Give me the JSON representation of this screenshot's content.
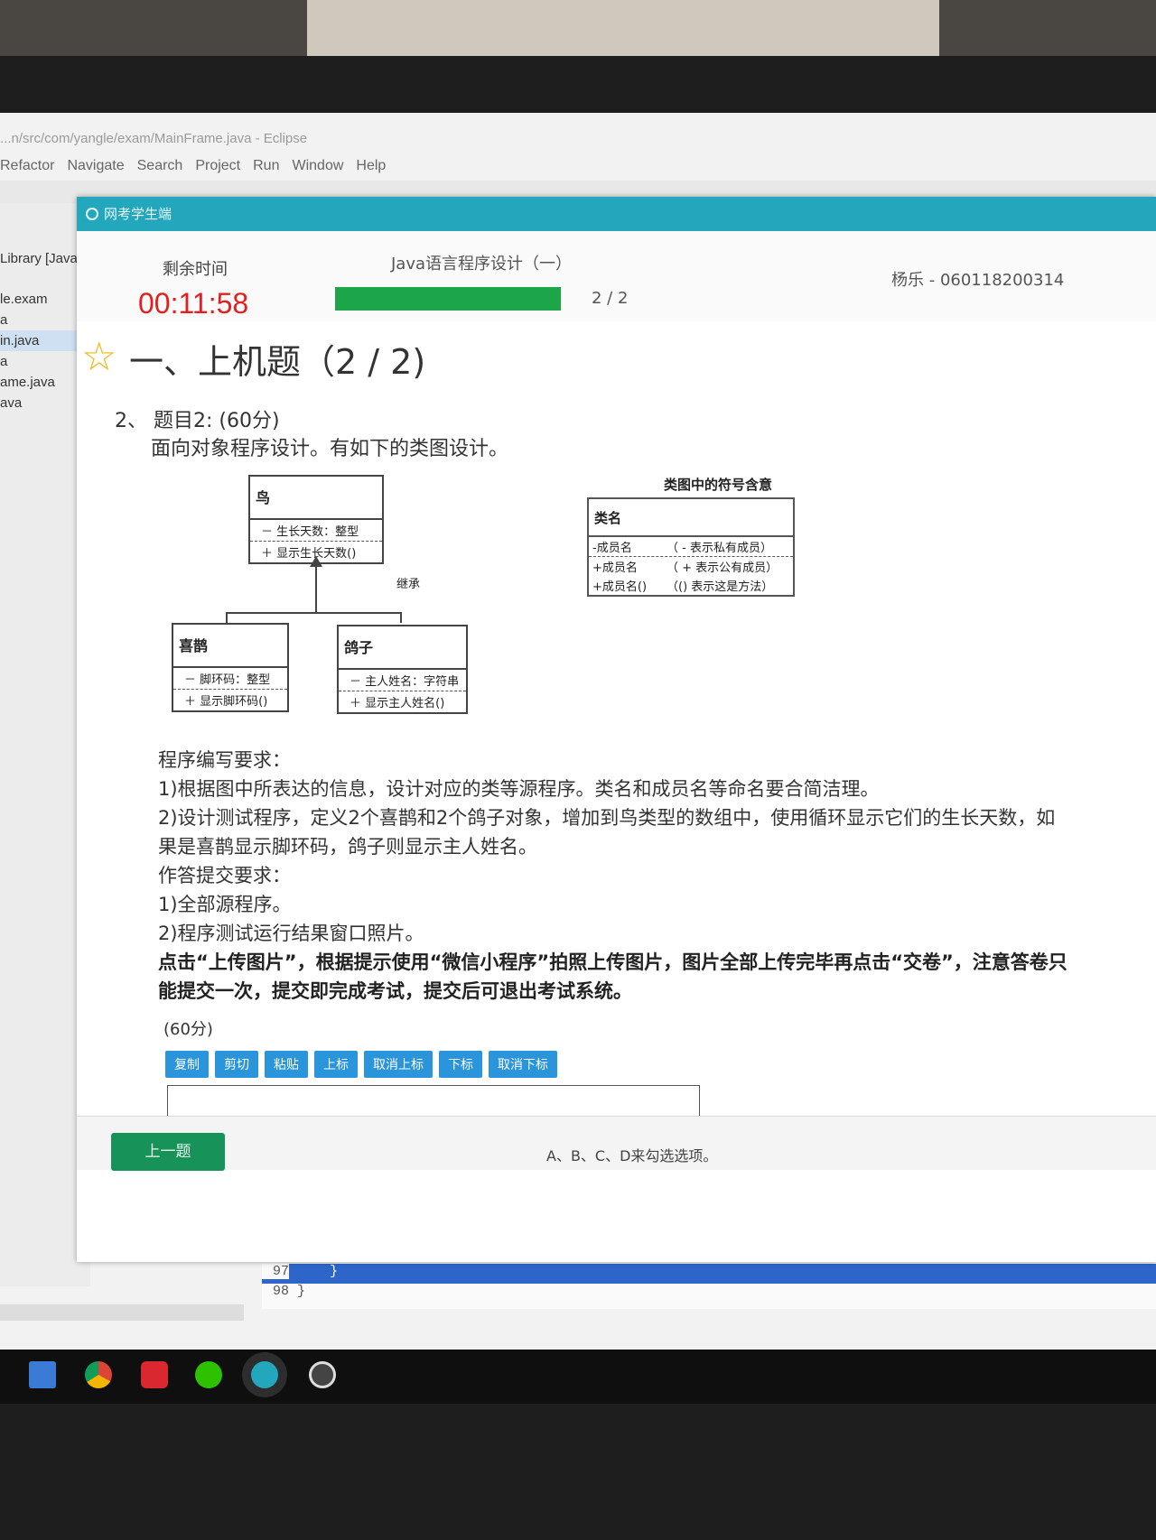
{
  "eclipse": {
    "title": "...n/src/com/yangle/exam/MainFrame.java - Eclipse",
    "menu": [
      "Refactor",
      "Navigate",
      "Search",
      "Project",
      "Run",
      "Window",
      "Help"
    ],
    "tree": [
      "Library [Java",
      "le.exam",
      "a",
      "in.java",
      "a",
      "ame.java",
      "ava"
    ],
    "code_lines": [
      {
        "num": "97",
        "text": "    }"
      },
      {
        "num": "98",
        "text": "}"
      }
    ]
  },
  "exam": {
    "window_title": "网考学生端",
    "remaining_label": "剩余时间",
    "timer": "00:11:58",
    "course": "Java语言程序设计（一）",
    "progress_text": "2 / 2",
    "progress_fraction": 1.0,
    "student": "杨乐 - 060118200314",
    "section_heading": "一、上机题（2 / 2)",
    "question_line": "2、 题目2:     (60分)",
    "question_desc": "面向对象程序设计。有如下的类图设计。",
    "uml": {
      "parent": {
        "name": "鸟",
        "attr": "－ 生长天数：整型",
        "op": "＋ 显示生长天数()"
      },
      "child1": {
        "name": "喜鹊",
        "attr": "－ 脚环码：整型",
        "op": "＋ 显示脚环码()"
      },
      "child2": {
        "name": "鸽子",
        "attr": "－ 主人姓名：字符串",
        "op": "＋ 显示主人姓名()"
      },
      "inherit_label": "继承"
    },
    "legend": {
      "title": "类图中的符号含意",
      "class_name": "类名",
      "rows": [
        {
          "k": "-成员名",
          "v": "（ - 表示私有成员）"
        },
        {
          "k": "+成员名",
          "v": "（ + 表示公有成员）"
        },
        {
          "k": "+成员名()",
          "v": "（() 表示这是方法）"
        }
      ]
    },
    "requirements": [
      "程序编写要求：",
      "1)根据图中所表达的信息，设计对应的类等源程序。类名和成员名等命名要合简洁理。",
      "2)设计测试程序，定义2个喜鹊和2个鸽子对象，增加到鸟类型的数组中，使用循环显示它们的生长天数，如",
      "果是喜鹊显示脚环码，鸽子则显示主人姓名。",
      "作答提交要求：",
      "1)全部源程序。",
      "2)程序测试运行结果窗口照片。"
    ],
    "bold_note_1": "点击“上传图片”，根据提示使用“微信小程序”拍照上传图片，图片全部上传完毕再点击“交卷”，注意答卷只",
    "bold_note_2": "能提交一次，提交即完成考试，提交后可退出考试系统。",
    "score": "(60分)",
    "toolbar_buttons": [
      "复制",
      "剪切",
      "粘贴",
      "上标",
      "取消上标",
      "下标",
      "取消下标"
    ],
    "prev_button": "上一题",
    "footer_hint": "A、B、C、D来勾选选项。"
  },
  "colors": {
    "titlebar": "#22a7bd",
    "timer": "#e31f1f",
    "progress": "#1da54a",
    "button": "#2b95db",
    "prev_button": "#17935a",
    "star": "#f1b81b"
  }
}
